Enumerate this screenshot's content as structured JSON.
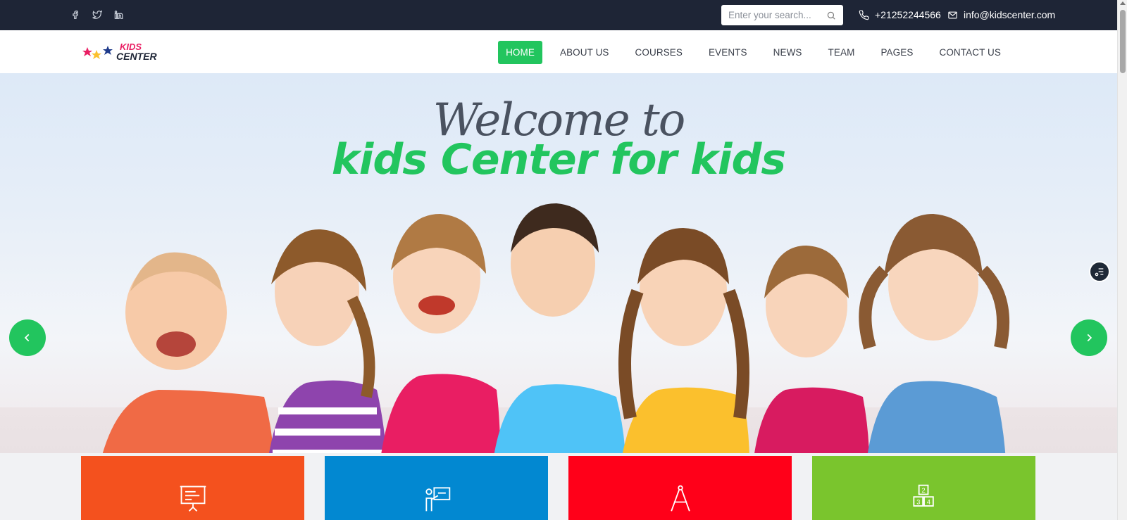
{
  "topbar": {
    "social": [
      "facebook-icon",
      "twitter-icon",
      "linkedin-icon"
    ],
    "search_placeholder": "Enter your search...",
    "phone": "+21252244566",
    "email": "info@kidscenter.com"
  },
  "logo": {
    "line1": "KIDS",
    "line2": "CENTER"
  },
  "nav": {
    "items": [
      {
        "label": "HOME",
        "active": true
      },
      {
        "label": "ABOUT US"
      },
      {
        "label": "COURSES"
      },
      {
        "label": "EVENTS"
      },
      {
        "label": "NEWS"
      },
      {
        "label": "TEAM"
      },
      {
        "label": "PAGES"
      },
      {
        "label": "CONTACT US"
      }
    ]
  },
  "hero": {
    "welcome": "Welcome to",
    "headline": "kids Center for kids",
    "prev_icon": "chevron-left-icon",
    "next_icon": "chevron-right-icon"
  },
  "cards": [
    {
      "icon": "presentation-board-icon",
      "color": "#f4511e"
    },
    {
      "icon": "teacher-icon",
      "color": "#0288d1"
    },
    {
      "icon": "compass-icon",
      "color": "#ff0019"
    },
    {
      "icon": "number-blocks-icon",
      "color": "#7ac52d"
    }
  ],
  "colors": {
    "accent": "#22c55e",
    "topbar": "#1e2536"
  }
}
